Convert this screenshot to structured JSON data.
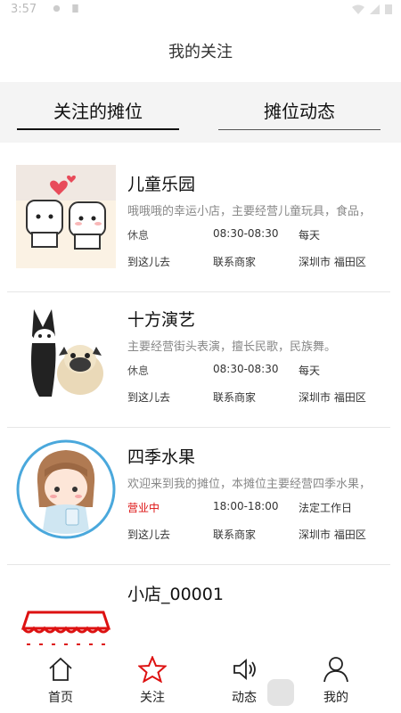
{
  "status_bar": {
    "time": "3:57"
  },
  "header": {
    "title": "我的关注"
  },
  "tabs": [
    {
      "label": "关注的摊位",
      "active": true
    },
    {
      "label": "摊位动态",
      "active": false
    }
  ],
  "shops": [
    {
      "name": "儿童乐园",
      "desc": "哦哦哦的幸运小店，主要经营儿童玩具，食品，",
      "status": "休息",
      "status_color": "#555555",
      "hours": "08:30-08:30",
      "days": "每天",
      "go_label": "到这儿去",
      "contact_label": "联系商家",
      "location": "深圳市 福田区",
      "image": "cute-cartoon-couple-image"
    },
    {
      "name": "十方演艺",
      "desc": "主要经营街头表演，擅长民歌，民族舞。",
      "status": "休息",
      "status_color": "#555555",
      "hours": "08:30-08:30",
      "days": "每天",
      "go_label": "到这儿去",
      "contact_label": "联系商家",
      "location": "深圳市 福田区",
      "image": "dogs-cartoon-image"
    },
    {
      "name": "四季水果",
      "desc": "欢迎来到我的摊位，本摊位主要经营四季水果，",
      "status": "营业中",
      "status_color": "#dd1111",
      "hours": "18:00-18:00",
      "days": "法定工作日",
      "go_label": "到这儿去",
      "contact_label": "联系商家",
      "location": "深圳市 福田区",
      "image": "girl-avatar-image"
    },
    {
      "name": "小店_00001",
      "image": "shop-awning-image"
    }
  ],
  "bottom_nav": [
    {
      "label": "首页",
      "icon": "home-icon",
      "active": false
    },
    {
      "label": "关注",
      "icon": "star-icon",
      "active": true,
      "color": "#d11"
    },
    {
      "label": "动态",
      "icon": "speaker-icon",
      "active": false
    },
    {
      "label": "我的",
      "icon": "user-icon",
      "active": false
    }
  ]
}
